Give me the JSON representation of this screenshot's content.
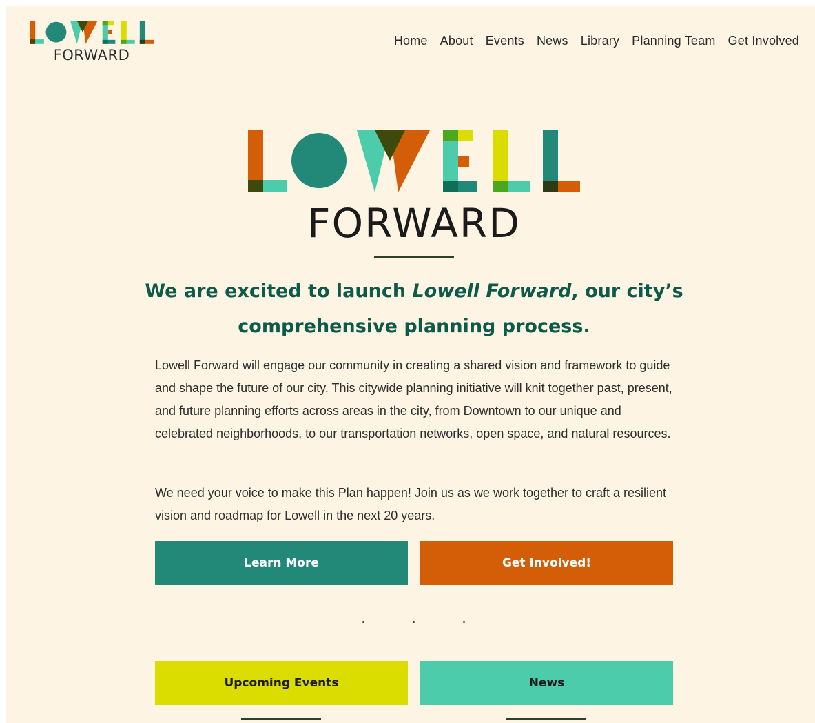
{
  "brand": {
    "logo_letters": "LOWELL",
    "logo_word": "FORWARD"
  },
  "nav": {
    "items": [
      "Home",
      "About",
      "Events",
      "News",
      "Library",
      "Planning Team",
      "Get Involved"
    ]
  },
  "hero": {
    "logo_letters": "LOWELL",
    "logo_word": "FORWARD",
    "headline_before": "We are excited to launch ",
    "headline_em": "Lowell Forward",
    "headline_after": ", our city’s comprehensive planning process.",
    "paragraph1": "Lowell Forward will engage our community in creating a shared vision and framework to guide and shape the future of our city. This citywide planning initiative will knit together past, present, and future planning efforts across areas in the city, from Downtown to our unique and celebrated neighborhoods, to our transportation networks, open space, and natural resources.",
    "paragraph2": "We need your voice to make this Plan happen! Join us as we work together to craft a resilient vision and roadmap for Lowell in the next 20 years."
  },
  "buttons": {
    "learn_more": "Learn More",
    "get_involved": "Get Involved!",
    "upcoming_events": "Upcoming Events",
    "news": "News"
  },
  "colors": {
    "background": "#fdf4e3",
    "teal": "#228877",
    "orange": "#d45d07",
    "lime": "#dbdc00",
    "mint": "#4cccaa",
    "heading": "#0e5a4a"
  }
}
